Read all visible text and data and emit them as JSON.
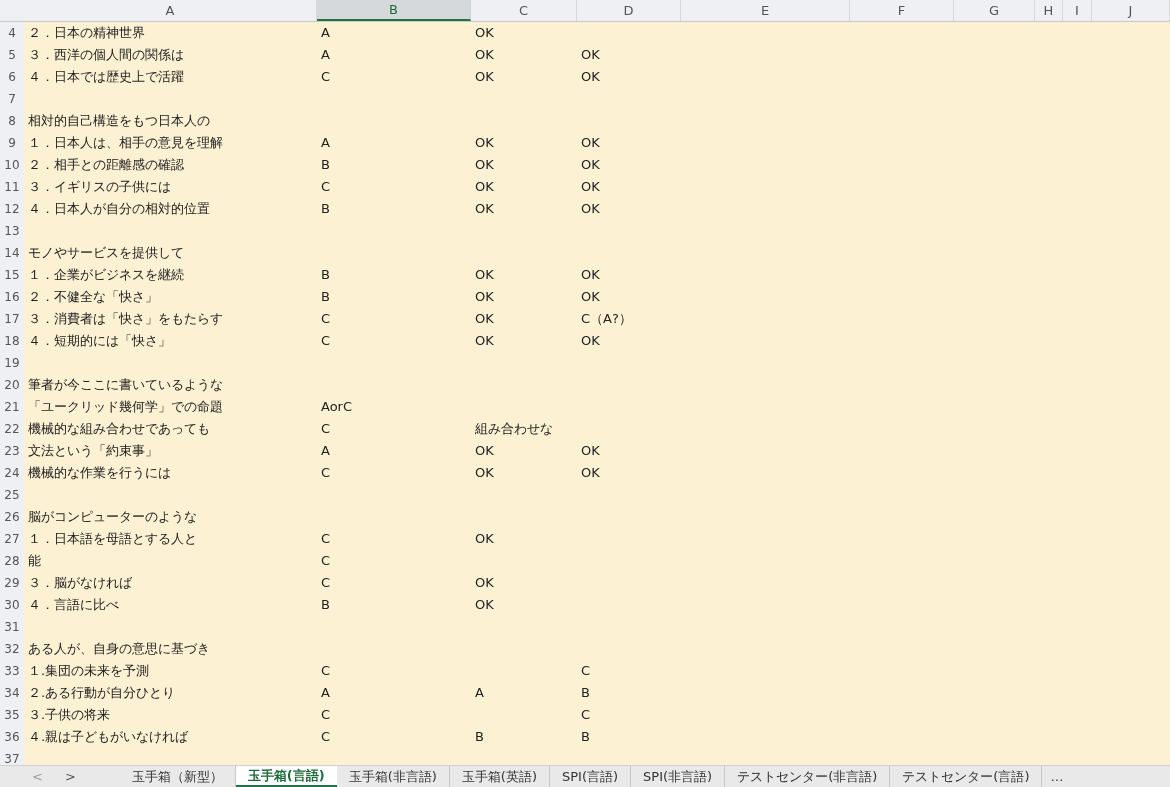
{
  "columns": [
    {
      "label": "A",
      "selected": false
    },
    {
      "label": "B",
      "selected": true
    },
    {
      "label": "C",
      "selected": false
    },
    {
      "label": "D",
      "selected": false
    },
    {
      "label": "E",
      "selected": false
    },
    {
      "label": "F",
      "selected": false
    },
    {
      "label": "G",
      "selected": false
    },
    {
      "label": "H",
      "selected": false
    },
    {
      "label": "I",
      "selected": false
    },
    {
      "label": "J",
      "selected": false
    }
  ],
  "rows": [
    {
      "num": "4",
      "cells": [
        "２．日本の精神世界",
        "A",
        "OK",
        null
      ]
    },
    {
      "num": "5",
      "cells": [
        "３．西洋の個人間の関係は",
        "A",
        "OK",
        "OK"
      ]
    },
    {
      "num": "6",
      "cells": [
        "４．日本では歴史上で活躍",
        "C",
        "OK",
        "OK"
      ]
    },
    {
      "num": "7",
      "cells": [
        null,
        null,
        null,
        null
      ]
    },
    {
      "num": "8",
      "cells": [
        "相対的自己構造をもつ日本人の",
        null,
        null,
        null
      ]
    },
    {
      "num": "9",
      "cells": [
        "１．日本人は、相手の意見を理解",
        "A",
        "OK",
        "OK"
      ]
    },
    {
      "num": "10",
      "cells": [
        "２．相手との距離感の確認",
        "B",
        "OK",
        "OK"
      ]
    },
    {
      "num": "11",
      "cells": [
        "３．イギリスの子供には",
        "C",
        "OK",
        "OK"
      ]
    },
    {
      "num": "12",
      "cells": [
        "４．日本人が自分の相対的位置",
        "B",
        "OK",
        "OK"
      ]
    },
    {
      "num": "13",
      "cells": [
        null,
        null,
        null,
        null
      ]
    },
    {
      "num": "14",
      "cells": [
        "モノやサービスを提供して",
        null,
        null,
        null
      ]
    },
    {
      "num": "15",
      "cells": [
        "１．企業がビジネスを継続",
        "B",
        "OK",
        "OK"
      ]
    },
    {
      "num": "16",
      "cells": [
        "２．不健全な「快さ」",
        "B",
        "OK",
        "OK"
      ]
    },
    {
      "num": "17",
      "cells": [
        "３．消費者は「快さ」をもたらす",
        "C",
        "OK",
        "C（A?）"
      ]
    },
    {
      "num": "18",
      "cells": [
        "４．短期的には「快さ」",
        "C",
        "OK",
        "OK"
      ]
    },
    {
      "num": "19",
      "cells": [
        null,
        null,
        null,
        null
      ]
    },
    {
      "num": "20",
      "cells": [
        "筆者が今ここに書いているような",
        null,
        null,
        null
      ]
    },
    {
      "num": "21",
      "cells": [
        "「ユークリッド幾何学」での命題",
        "AorC",
        null,
        null
      ]
    },
    {
      "num": "22",
      "cells": [
        "機械的な組み合わせであっても",
        "C",
        "組み合わせな",
        null
      ]
    },
    {
      "num": "23",
      "cells": [
        "文法という「約束事」",
        "A",
        "OK",
        "OK"
      ]
    },
    {
      "num": "24",
      "cells": [
        "機械的な作業を行うには",
        "C",
        "OK",
        "OK"
      ]
    },
    {
      "num": "25",
      "cells": [
        null,
        null,
        null,
        null
      ]
    },
    {
      "num": "26",
      "cells": [
        "脳がコンピューターのような",
        null,
        null,
        null
      ]
    },
    {
      "num": "27",
      "cells": [
        "１．日本語を母語とする人と",
        "C",
        "OK",
        null
      ]
    },
    {
      "num": "28",
      "cells": [
        "能",
        "C",
        null,
        null
      ]
    },
    {
      "num": "29",
      "cells": [
        "３．脳がなければ",
        "C",
        "OK",
        null
      ]
    },
    {
      "num": "30",
      "cells": [
        "４．言語に比べ",
        "B",
        "OK",
        null
      ]
    },
    {
      "num": "31",
      "cells": [
        null,
        null,
        null,
        null
      ]
    },
    {
      "num": "32",
      "cells": [
        "ある人が、自身の意思に基づき",
        null,
        null,
        null
      ]
    },
    {
      "num": "33",
      "cells": [
        "１.集団の未来を予測",
        "C",
        null,
        "C"
      ]
    },
    {
      "num": "34",
      "cells": [
        "２.ある行動が自分ひとり",
        "A",
        "A",
        "B"
      ]
    },
    {
      "num": "35",
      "cells": [
        "３.子供の将来",
        "C",
        null,
        "C"
      ]
    },
    {
      "num": "36",
      "cells": [
        "４.親は子どもがいなければ",
        "C",
        "B",
        "B"
      ]
    },
    {
      "num": "37",
      "cells": [
        null,
        null,
        null,
        null
      ]
    }
  ],
  "sheet_nav": {
    "prev": "<",
    "next": ">"
  },
  "sheet_tabs": [
    {
      "label": "玉手箱（新型）",
      "selected": false
    },
    {
      "label": "玉手箱(言語)",
      "selected": true
    },
    {
      "label": "玉手箱(非言語)",
      "selected": false
    },
    {
      "label": "玉手箱(英語)",
      "selected": false
    },
    {
      "label": "SPI(言語)",
      "selected": false
    },
    {
      "label": "SPI(非言語)",
      "selected": false
    },
    {
      "label": "テストセンター(非言語)",
      "selected": false
    },
    {
      "label": "テストセンター(言語)",
      "selected": false
    }
  ],
  "more_tabs": "…"
}
